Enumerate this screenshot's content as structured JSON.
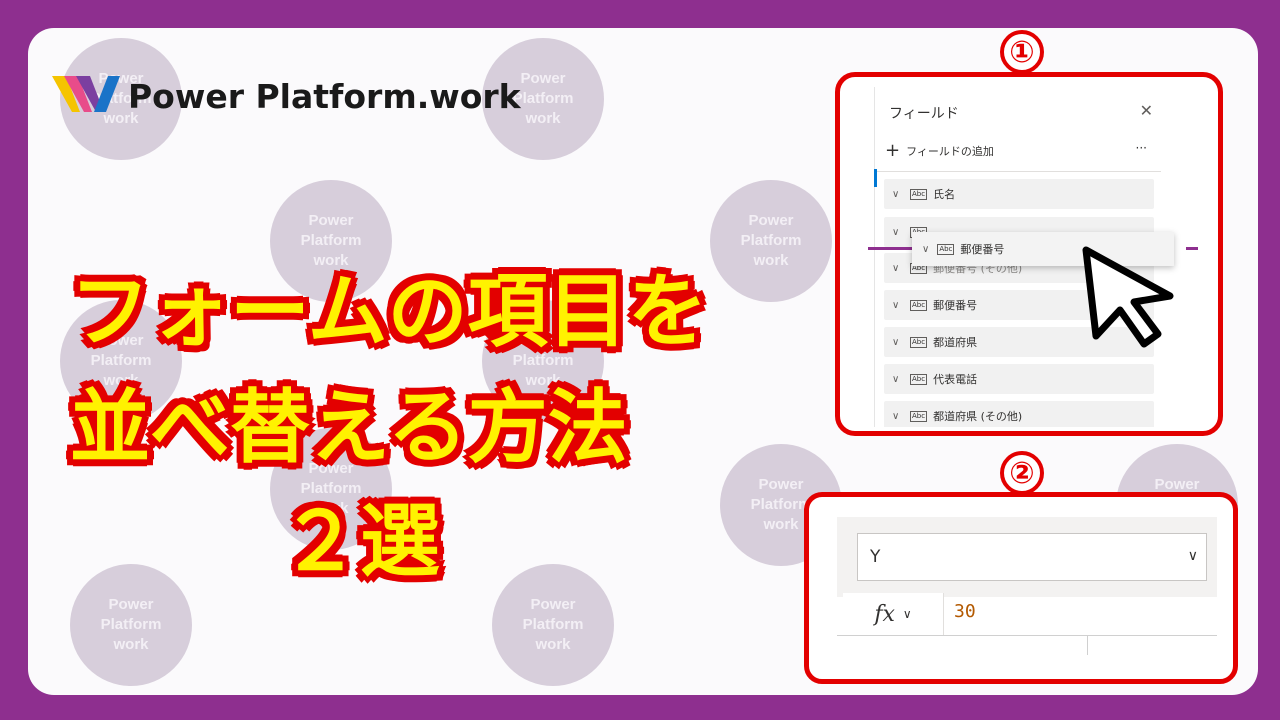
{
  "brand": {
    "name": "Power Platform.work",
    "colors": {
      "frame": "#8e2f8f",
      "accent_red": "#e30000",
      "title_yellow": "#fff200"
    }
  },
  "watermark": {
    "lines": [
      "Power",
      "Platform",
      "work"
    ]
  },
  "headline": {
    "line1": "フォームの項目を",
    "line2": "並べ替える方法",
    "line3": "２選"
  },
  "steps": {
    "one": "①",
    "two": "②"
  },
  "fields_panel": {
    "title": "フィールド",
    "close_icon": "close-icon",
    "add_label": "フィールドの追加",
    "more": "···",
    "items": [
      {
        "label": "氏名"
      },
      {
        "label": "郵便番号 (その他)"
      },
      {
        "label": "郵便番号"
      },
      {
        "label": "都道府県"
      },
      {
        "label": "代表電話"
      },
      {
        "label": "都道府県 (その他)"
      }
    ],
    "dragging_item": "郵便番号"
  },
  "formula_bar": {
    "property": "Y",
    "fx": "fx",
    "value": "30"
  }
}
